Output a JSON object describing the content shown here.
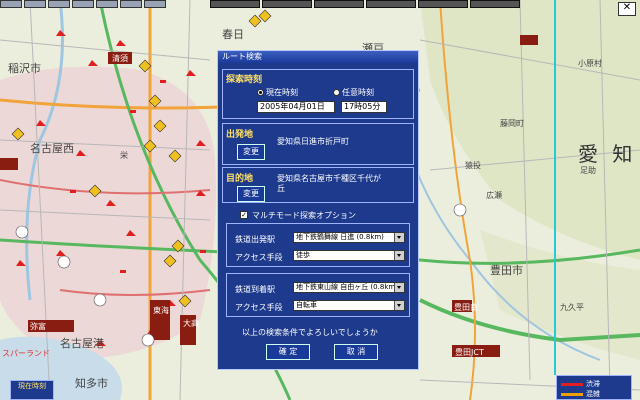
{
  "dialog": {
    "title": "ルート検索",
    "search_time": {
      "header": "探索時刻",
      "option_now": "現在時刻",
      "option_any": "任意時刻",
      "selected": "now",
      "date_value": "2005年04月01日",
      "time_value": "17時05分"
    },
    "origin": {
      "header": "出発地",
      "change_label": "変更",
      "address": "愛知県日進市折戸町"
    },
    "destination": {
      "header": "目的地",
      "change_label": "変更",
      "address_line1": "愛知県名古屋市千種区千代が",
      "address_line2": "丘"
    },
    "multimode": {
      "checked": true,
      "label": "マルチモード探索オプション",
      "departure_station_label": "鉄道出発駅",
      "departure_station_value": "地下鉄鶴舞線 日進 (0.8km)",
      "access_means_label_1": "アクセス手段",
      "access_means_value_1": "徒歩",
      "arrival_station_label": "鉄道到着駅",
      "arrival_station_value": "地下鉄東山線 自由ヶ丘 (0.8km)",
      "access_means_label_2": "アクセス手段",
      "access_means_value_2": "自転車"
    },
    "confirm_text": "以上の検索条件でよろしいでしょうか",
    "ok_label": "確 定",
    "cancel_label": "取 消"
  },
  "map": {
    "labels": {
      "aichi": "愛 知",
      "inazawa": "稲沢市",
      "nagoya": "名古屋西",
      "kiyosu": "清須",
      "nagoya_minato": "名古屋港",
      "toyota": "豊田市",
      "toyota_jct": "豊田JCT",
      "chita": "知多市",
      "kasugai": "春日",
      "seto": "瀬戸",
      "sanage": "猿投",
      "hirose": "広瀬",
      "ashisuke": "足助",
      "fujioka": "藤岡町",
      "obara": "小原村",
      "ohdaka": "大高",
      "tokai": "東海",
      "sakae": "栄",
      "yatomi": "弥富",
      "spaland": "スパーランド",
      "kuma": "九久平"
    },
    "route_label": "豊田南"
  },
  "current_time_widget": {
    "label": "現在時刻"
  },
  "legend": {
    "item1": "渋滞",
    "item2": "混雑",
    "color1": "#e02020",
    "color2": "#f0a000"
  },
  "colors": {
    "dialog_bg": "#1d3a8c",
    "header_yellow": "#ffe066",
    "incident_red": "#e02020"
  }
}
